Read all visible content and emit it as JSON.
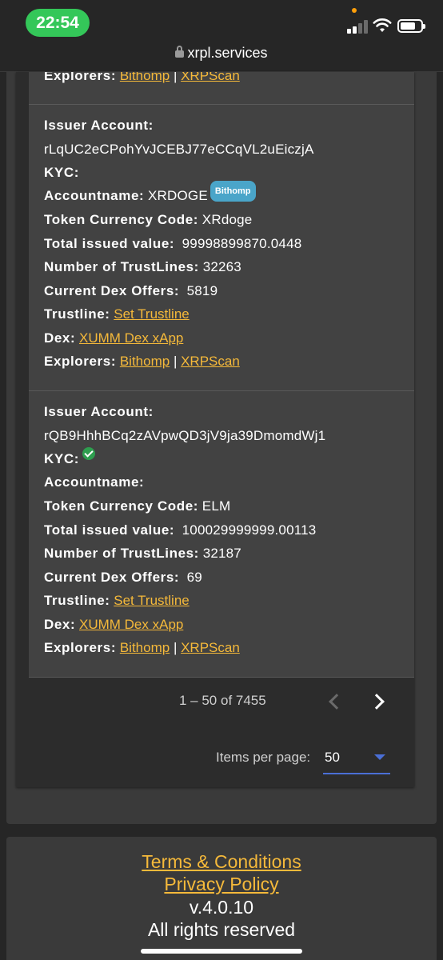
{
  "status_bar": {
    "time": "22:54"
  },
  "browser": {
    "url": "xrpl.services"
  },
  "labels": {
    "issuer_account": "Issuer Account:",
    "kyc": "KYC:",
    "accountname": "Accountname:",
    "token_currency_code": "Token Currency Code:",
    "total_issued_value": "Total issued value:",
    "number_of_trustlines": "Number of TrustLines:",
    "current_dex_offers": "Current Dex Offers:",
    "trustline": "Trustline:",
    "dex": "Dex:",
    "explorers": "Explorers:",
    "explorer_separator": "|"
  },
  "links": {
    "set_trustline": "Set Trustline",
    "xumm_dex": "XUMM Dex xApp",
    "bithomp": "Bithomp",
    "xrpscan": "XRPScan"
  },
  "tokens": [
    {
      "issuer_account": "rLqUC2eCPohYvJCEBJ77eCCqVL2uEiczjA",
      "kyc_verified": false,
      "accountname": "XRDOGE",
      "accountname_badge": "Bithomp",
      "currency_code": "XRdoge",
      "total_issued_value": "99998899870.0448",
      "trustlines": "32263",
      "dex_offers": "5819"
    },
    {
      "issuer_account": "rQB9HhhBCq2zAVpwQD3jV9ja39DmomdWj1",
      "kyc_verified": true,
      "accountname": "",
      "currency_code": "ELM",
      "total_issued_value": "100029999999.00113",
      "trustlines": "32187",
      "dex_offers": "69"
    }
  ],
  "paginator": {
    "range": "1 – 50 of 7455",
    "items_per_page_label": "Items per page:",
    "items_per_page_value": "50"
  },
  "footer": {
    "terms": "Terms & Conditions",
    "privacy": "Privacy Policy",
    "version": "v.4.0.10",
    "rights": "All rights reserved"
  },
  "colors": {
    "accent_link": "#f5b93a",
    "status_pill": "#34c759",
    "badge": "#4aa5c9",
    "kyc_check": "#2e9e4f",
    "select_underline": "#4a6fd6"
  },
  "icons": [
    "lock-icon",
    "signal-icon",
    "wifi-icon",
    "battery-icon",
    "check-circle-icon",
    "chevron-left-icon",
    "chevron-right-icon",
    "dropdown-arrow-icon"
  ]
}
